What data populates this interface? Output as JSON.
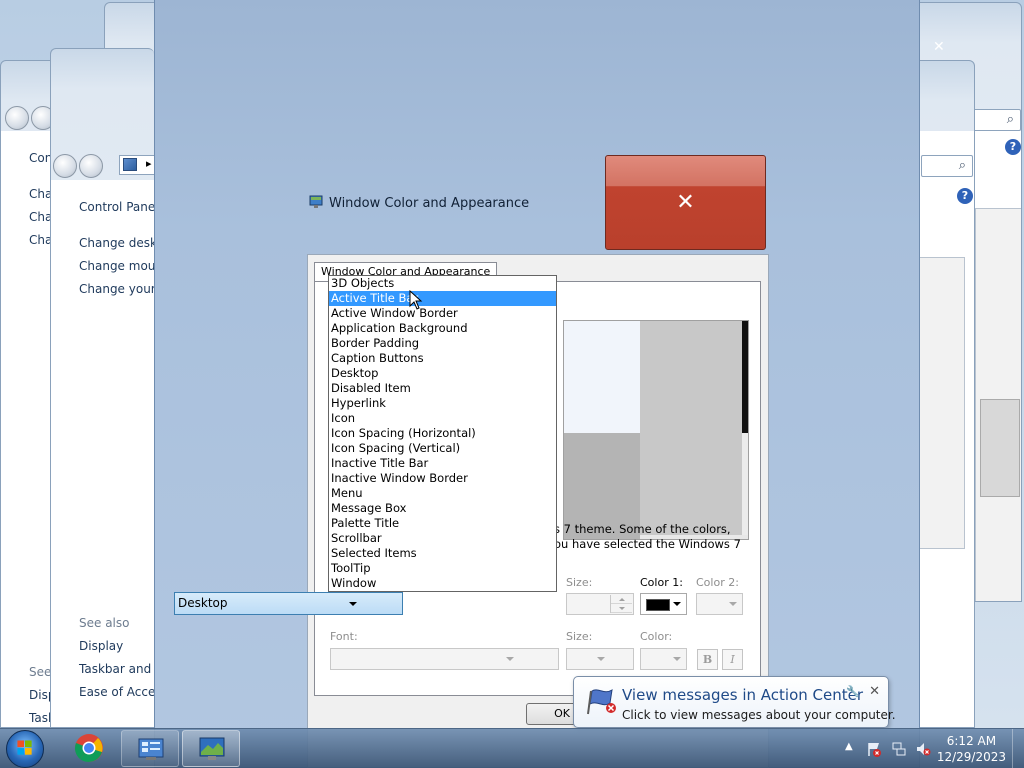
{
  "background_windows": {
    "back_window_1": {
      "close_glyph": "✕"
    },
    "back_window_2": {
      "partial_title": "Cont",
      "links": [
        "Cha",
        "Cha",
        "Cha"
      ],
      "see_also_partial": "See",
      "see_also_links": [
        "Disp",
        "Taskbar and S"
      ]
    },
    "back_window_3": {
      "breadcrumb": "Control Panel",
      "links": [
        "Change deskto",
        "Change mous",
        "Change your a"
      ],
      "see_also_heading": "See also",
      "see_also_links": [
        "Display",
        "Taskbar and St",
        "Ease of Access"
      ]
    }
  },
  "main_window": {
    "title": "Window Color and Appearance",
    "close_glyph": "✕"
  },
  "dialog": {
    "tab_label": "Window Color and Appearance",
    "info_text_line1": "s 7 theme.  Some of the colors,",
    "info_text_line2": "ou have selected the Windows 7",
    "item_selected": "Desktop",
    "item_options": [
      "3D Objects",
      "Active Title Bar",
      "Active Window Border",
      "Application Background",
      "Border Padding",
      "Caption Buttons",
      "Desktop",
      "Disabled Item",
      "Hyperlink",
      "Icon",
      "Icon Spacing (Horizontal)",
      "Icon Spacing (Vertical)",
      "Inactive Title Bar",
      "Inactive Window Border",
      "Menu",
      "Message Box",
      "Palette Title",
      "Scrollbar",
      "Selected Items",
      "ToolTip",
      "Window"
    ],
    "highlighted_option": "Active Title Bar",
    "labels": {
      "size": "Size:",
      "color1": "Color 1:",
      "color2": "Color 2:",
      "font": "Font:",
      "font_size": "Size:",
      "font_color": "Color:"
    },
    "bold_glyph": "B",
    "italic_glyph": "I",
    "ok_label": "OK",
    "color1_value": "#000000"
  },
  "notification": {
    "title": "View messages in Action Center",
    "text": "Click to view messages about your computer.",
    "close_glyph": "✕",
    "wrench_glyph": "🔧"
  },
  "taskbar": {
    "time": "6:12 AM",
    "date": "12/29/2023",
    "icons": [
      "start-orb-icon",
      "chrome-icon",
      "control-panel-icon",
      "display-settings-icon"
    ]
  },
  "colors": {
    "selection": "#3399ff",
    "close_button": "#c0432f",
    "taskbar": "#3c5676"
  }
}
